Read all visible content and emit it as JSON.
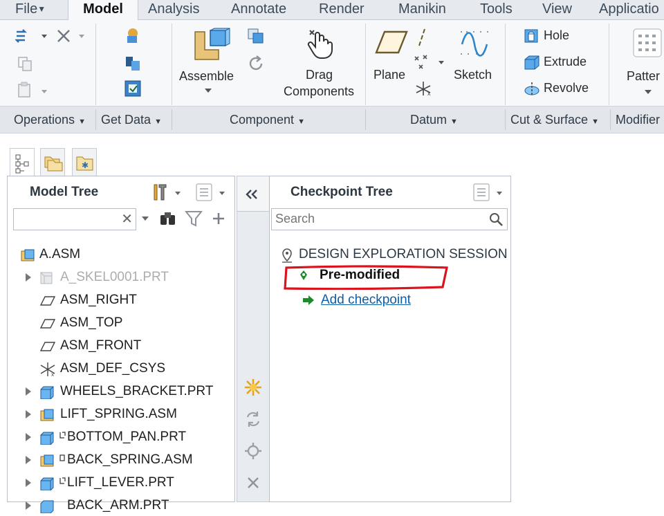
{
  "tabs": [
    {
      "label": "File",
      "has_menu": true
    },
    {
      "label": "Model",
      "active": true
    },
    {
      "label": "Analysis"
    },
    {
      "label": "Annotate"
    },
    {
      "label": "Render"
    },
    {
      "label": "Manikin"
    },
    {
      "label": "Tools"
    },
    {
      "label": "View"
    },
    {
      "label": "Applicatio"
    }
  ],
  "ribbon": {
    "assemble_label": "Assemble",
    "drag_components_line1": "Drag",
    "drag_components_line2": "Components",
    "plane_label": "Plane",
    "sketch_label": "Sketch",
    "hole_label": "Hole",
    "extrude_label": "Extrude",
    "revolve_label": "Revolve",
    "pattern_label": "Patter"
  },
  "groups": [
    {
      "label": "Operations"
    },
    {
      "label": "Get Data"
    },
    {
      "label": "Component"
    },
    {
      "label": "Datum"
    },
    {
      "label": "Cut & Surface"
    },
    {
      "label": "Modifier"
    }
  ],
  "model_tree": {
    "title": "Model Tree",
    "filter_value": "",
    "items": [
      {
        "label": "A.ASM",
        "icon": "assembly-icon",
        "expandable": false,
        "dimmed": false
      },
      {
        "label": "A_SKEL0001.PRT",
        "icon": "skeleton-part-icon",
        "expandable": true,
        "dimmed": true
      },
      {
        "label": "ASM_RIGHT",
        "icon": "datum-plane-icon",
        "expandable": false,
        "dimmed": false
      },
      {
        "label": "ASM_TOP",
        "icon": "datum-plane-icon",
        "expandable": false,
        "dimmed": false
      },
      {
        "label": "ASM_FRONT",
        "icon": "datum-plane-icon",
        "expandable": false,
        "dimmed": false
      },
      {
        "label": "ASM_DEF_CSYS",
        "icon": "csys-icon",
        "expandable": false,
        "dimmed": false
      },
      {
        "label": "WHEELS_BRACKET.PRT",
        "icon": "part-icon",
        "expandable": true,
        "dimmed": false
      },
      {
        "label": "LIFT_SPRING.ASM",
        "icon": "assembly-icon",
        "expandable": true,
        "dimmed": false
      },
      {
        "label": "BOTTOM_PAN.PRT",
        "icon": "part-icon",
        "expandable": true,
        "dimmed": false,
        "flexible": true
      },
      {
        "label": "BACK_SPRING.ASM",
        "icon": "assembly-icon",
        "expandable": true,
        "dimmed": false,
        "flexible": true
      },
      {
        "label": "LIFT_LEVER.PRT",
        "icon": "part-icon",
        "expandable": true,
        "dimmed": false,
        "flexible": true
      },
      {
        "label": "BACK_ARM.PRT",
        "icon": "part-icon",
        "expandable": true,
        "dimmed": false
      }
    ]
  },
  "checkpoint_tree": {
    "title": "Checkpoint Tree",
    "search_placeholder": "Search",
    "session_label": "DESIGN EXPLORATION SESSION",
    "current_checkpoint": "Pre-modified",
    "add_checkpoint": "Add checkpoint"
  },
  "colors": {
    "highlight_red": "#d9141c",
    "link_blue": "#0b5ea8",
    "accent_blue": "#3d8fd6",
    "arrow_green": "#1a8a2a"
  }
}
